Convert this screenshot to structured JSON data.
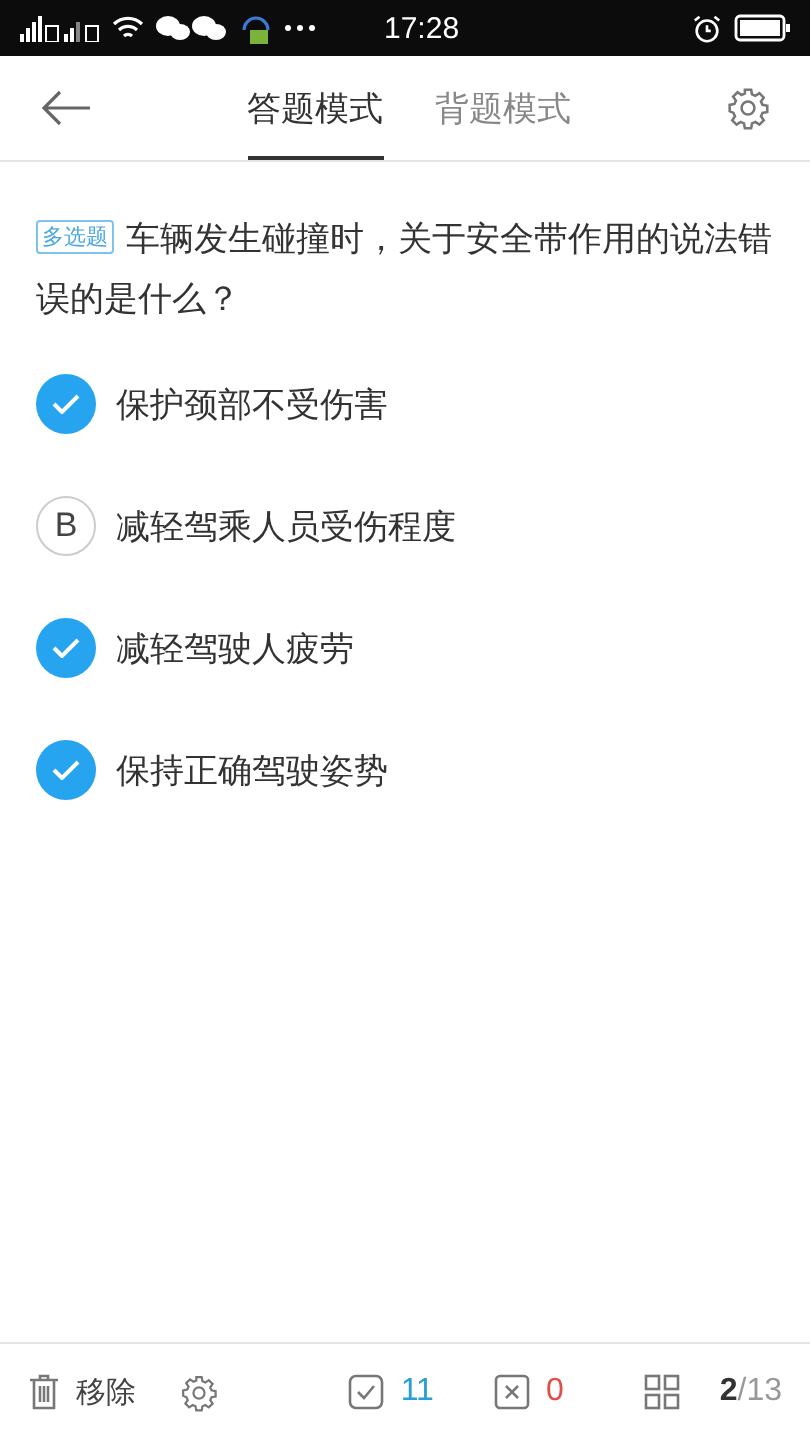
{
  "status_bar": {
    "time": "17:28"
  },
  "tabs": [
    {
      "label": "答题模式",
      "selected": true
    },
    {
      "label": "背题模式",
      "selected": false
    }
  ],
  "question": {
    "tag": "多选题",
    "text": "车辆发生碰撞时，关于安全带作用的说法错误的是什么？"
  },
  "options": [
    {
      "text": "保护颈部不受伤害",
      "selected": true
    },
    {
      "text": "减轻驾乘人员受伤程度",
      "selected": false,
      "letter": "B"
    },
    {
      "text": "减轻驾驶人疲劳",
      "selected": true
    },
    {
      "text": "保持正确驾驶姿势",
      "selected": true
    }
  ],
  "footer": {
    "remove": "移除",
    "correct": "11",
    "wrong": "0",
    "current": "2",
    "total": "/13"
  }
}
